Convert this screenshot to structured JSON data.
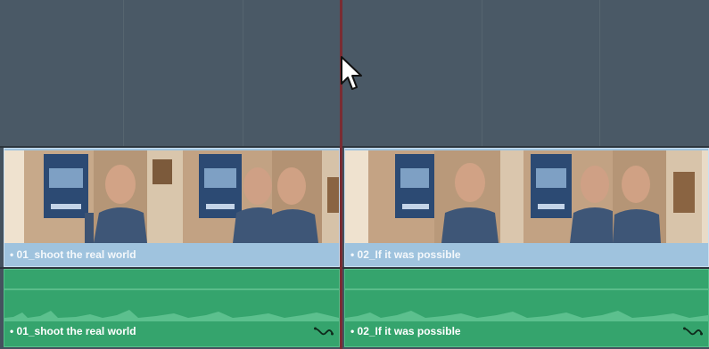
{
  "timeline": {
    "video_clips": [
      {
        "label": "• 01_shoot the real world"
      },
      {
        "label": "• 02_If it was possible"
      }
    ],
    "audio_clips": [
      {
        "label": "• 01_shoot the real world"
      },
      {
        "label": "• 02_If it was possible"
      }
    ]
  },
  "colors": {
    "video_clip": "#9fc3de",
    "audio_clip": "#35a46d",
    "playhead": "#7a2c33",
    "empty_track": "#4a5966"
  },
  "icons": {
    "audio_curve": "volume-curve-icon",
    "cursor": "mouse-pointer-icon"
  }
}
